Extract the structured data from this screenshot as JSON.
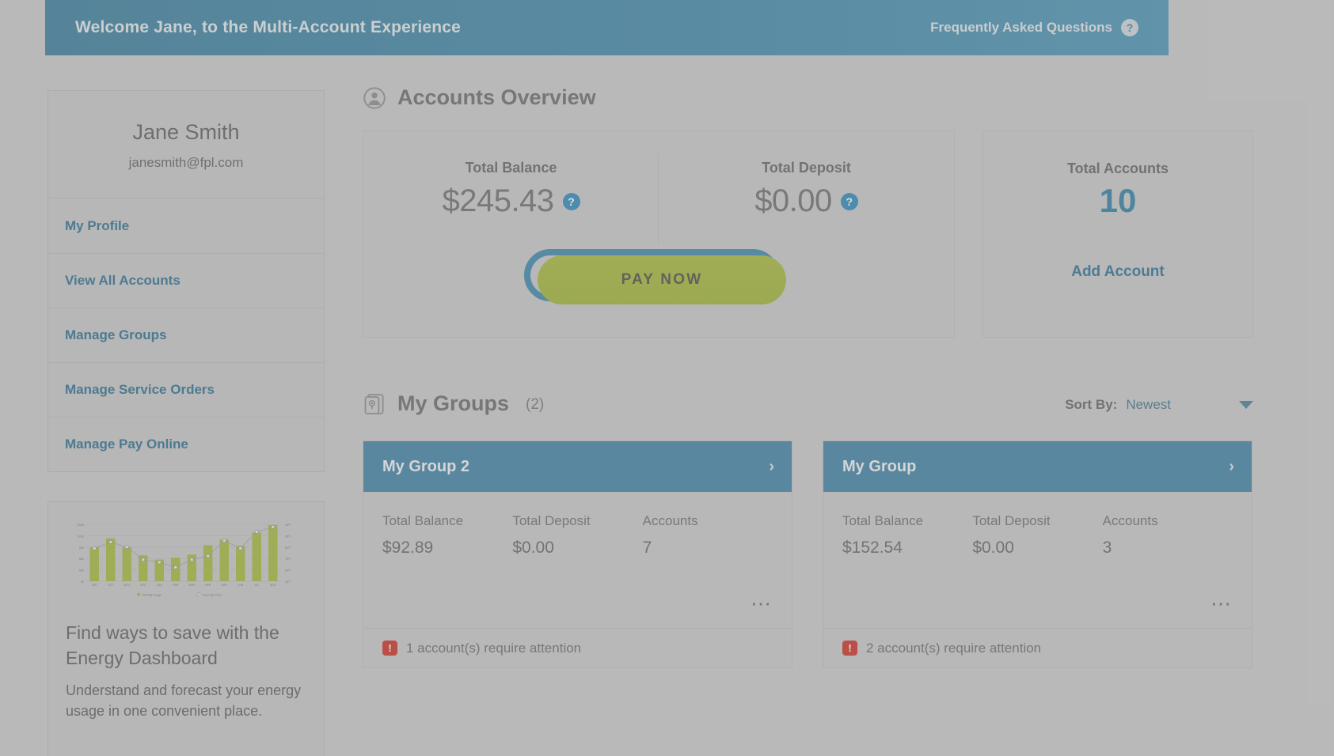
{
  "header": {
    "welcome": "Welcome Jane, to the Multi-Account Experience",
    "faq": "Frequently Asked Questions",
    "faq_icon": "question-mark-circle-icon",
    "bg": "#3f87a8"
  },
  "sidebar": {
    "name": "Jane Smith",
    "email": "janesmith@fpl.com",
    "items": [
      {
        "label": "My Profile"
      },
      {
        "label": "View All Accounts"
      },
      {
        "label": "Manage Groups"
      },
      {
        "label": "Manage Service Orders"
      },
      {
        "label": "Manage Pay Online"
      }
    ]
  },
  "promo": {
    "heading": "Find ways to save with the Energy Dashboard",
    "body": "Understand and forecast your energy usage in one convenient place."
  },
  "chart_data": {
    "type": "bar",
    "title": "",
    "categories": [
      "SEP",
      "OCT",
      "NOV",
      "DEC",
      "JAN",
      "FEB",
      "MAR",
      "APR",
      "MAY",
      "JUN",
      "JUL",
      "AUG"
    ],
    "series": [
      {
        "name": "Monthly Usage",
        "type": "bar",
        "color": "#a4b83c",
        "values": [
          90,
          113,
          90,
          68,
          57,
          62,
          70,
          95,
          110,
          93,
          128,
          148
        ]
      },
      {
        "name": "Avg High Temp",
        "type": "line",
        "color": "#9aa0a6",
        "values": [
          71,
          76,
          72,
          62,
          60,
          56,
          62,
          65,
          77,
          71,
          84,
          88
        ]
      }
    ],
    "ylabel": "",
    "ytick_labels": [
      "$0",
      "$30",
      "$60",
      "$90",
      "$120",
      "$150"
    ],
    "ylim": [
      0,
      150
    ],
    "y2tick_labels": [
      "45°F",
      "60°F",
      "75°F",
      "80°F",
      "85°F",
      "90°F"
    ],
    "y2lim": [
      45,
      90
    ],
    "legend": [
      "Monthly Usage",
      "Avg High Temp"
    ],
    "legend_position": "bottom",
    "grid": true
  },
  "accounts_overview": {
    "title": "Accounts Overview",
    "icon": "user-circle-icon",
    "total_balance_label": "Total Balance",
    "total_balance_value": "$245.43",
    "total_deposit_label": "Total Deposit",
    "total_deposit_value": "$0.00",
    "info_icon": "info-question-icon",
    "pay_now_label": "PAY NOW",
    "total_accounts_label": "Total Accounts",
    "total_accounts_value": "10",
    "add_account_label": "Add Account"
  },
  "groups": {
    "title": "My Groups",
    "icon": "card-pin-icon",
    "count": "(2)",
    "sort_label": "Sort By:",
    "sort_value": "Newest",
    "col_balance": "Total Balance",
    "col_deposit": "Total Deposit",
    "col_accounts": "Accounts",
    "items": [
      {
        "name": "My Group 2",
        "balance": "$92.89",
        "deposit": "$0.00",
        "accounts": "7",
        "alert": "1 account(s) require attention"
      },
      {
        "name": "My Group",
        "balance": "$152.54",
        "deposit": "$0.00",
        "accounts": "3",
        "alert": "2 account(s) require attention"
      }
    ]
  }
}
